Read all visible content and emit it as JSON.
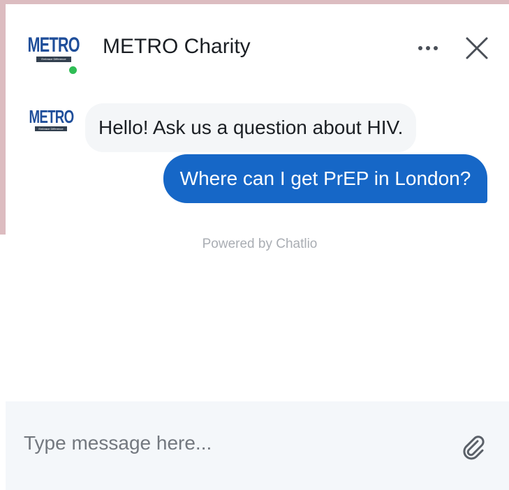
{
  "header": {
    "title": "METRO Charity",
    "online": true,
    "logo": {
      "word": "METRO",
      "tagline": "Embrace Difference"
    }
  },
  "messages": [
    {
      "from": "bot",
      "text": "Hello! Ask us a question about HIV."
    },
    {
      "from": "user",
      "text": "Where can I get PrEP in London?"
    }
  ],
  "footer": {
    "powered_by": "Powered by Chatlio"
  },
  "composer": {
    "value": "",
    "placeholder": "Type message here..."
  },
  "icons": {
    "menu": "more-dots-icon",
    "close": "close-icon",
    "attach": "paperclip-icon"
  },
  "colors": {
    "accent": "#1667c7",
    "online": "#2fbd55",
    "logo": "#1f4e9a",
    "backdrop": "#dcbcc0"
  }
}
